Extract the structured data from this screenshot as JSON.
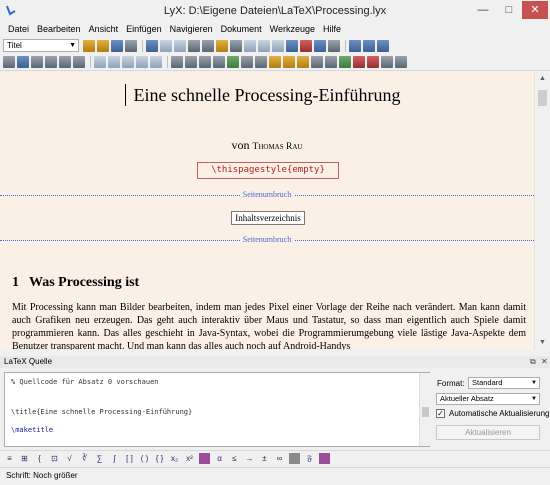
{
  "window": {
    "title": "LyX: D:\\Eigene Dateien\\LaTeX\\Processing.lyx",
    "minimize": "—",
    "maximize": "□",
    "close": "✕"
  },
  "menu": [
    "Datei",
    "Bearbeiten",
    "Ansicht",
    "Einfügen",
    "Navigieren",
    "Dokument",
    "Werkzeuge",
    "Hilfe"
  ],
  "toolbar": {
    "paragraph_style": "Titel"
  },
  "document": {
    "title": "Eine schnelle Processing-Einführung",
    "author_prefix": "von ",
    "author_name": "Thomas Rau",
    "ert": "\\thispagestyle{empty}",
    "pagebreak_label": "Seitenumbruch",
    "toc": "Inhaltsverzeichnis",
    "section_number": "1",
    "section_title": "Was Processing ist",
    "body": "Mit Processing kann man Bilder bearbeiten, indem man jedes Pixel einer Vorlage der Reihe nach verändert. Man kann damit auch Grafiken neu erzeugen. Das geht auch interaktiv über Maus und Tastatur, so dass man eigentlich auch Spiele damit programmieren kann. Das alles geschieht in Java-Syntax, wobei die Programmierumgebung viele lästige Java-Aspekte dem Benutzer transparent macht. Und man kann das alles auch noch auf Android-Handys"
  },
  "source_panel": {
    "title": "LaTeX Quelle",
    "line1": "% Quellcode für Absatz 0 vorschauen",
    "line2": "\\title{Eine schnelle Processing-Einführung}",
    "line3": "\\maketitle",
    "format_label": "Format:",
    "format_value": "Standard",
    "paragraph_value": "Aktueller Absatz",
    "auto_update_label": "Automatische Aktualisierung",
    "auto_update_checked": true,
    "update_button": "Aktualisieren"
  },
  "status": "Schrift: Noch größer",
  "colors": {
    "editor_bg": "#faf0e6",
    "ert_red": "#b22222",
    "pagebreak_blue": "#4a6ad0"
  }
}
